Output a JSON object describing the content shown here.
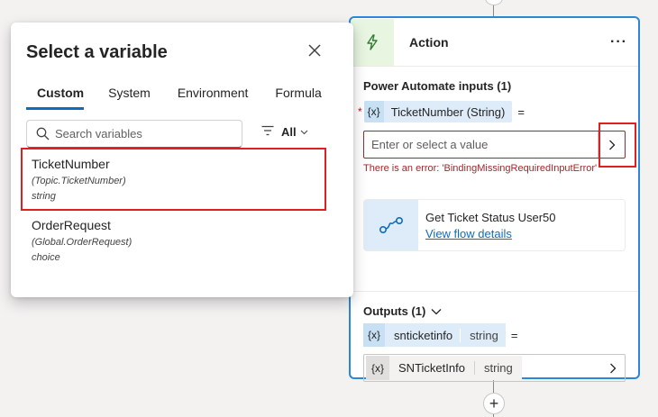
{
  "popup": {
    "title": "Select a variable",
    "tabs": [
      {
        "label": "Custom",
        "active": true
      },
      {
        "label": "System",
        "active": false
      },
      {
        "label": "Environment",
        "active": false
      },
      {
        "label": "Formula",
        "active": false
      }
    ],
    "search_placeholder": "Search variables",
    "filter_label": "All",
    "variables": [
      {
        "name": "TicketNumber",
        "scope": "(Topic.TicketNumber)",
        "type": "string"
      },
      {
        "name": "OrderRequest",
        "scope": "(Global.OrderRequest)",
        "type": "choice"
      }
    ]
  },
  "action": {
    "title": "Action",
    "more_label": "···",
    "inputs_title": "Power Automate inputs (1)",
    "required_mark": "*",
    "param_badge": "{x}",
    "param_label": "TicketNumber (String)",
    "equals": "=",
    "input_placeholder": "Enter or select a value",
    "error": "There is an error: 'BindingMissingRequiredInputError'",
    "flow_name": "Get Ticket Status User50",
    "flow_link": "View flow details",
    "outputs_title": "Outputs (1)",
    "output_badge": "{x}",
    "output_name": "snticketinfo",
    "output_type": "string",
    "output_equals": "=",
    "output_target_badge": "{x}",
    "output_target_name": "SNTicketInfo",
    "output_target_type": "string"
  },
  "add_node_label": "+"
}
